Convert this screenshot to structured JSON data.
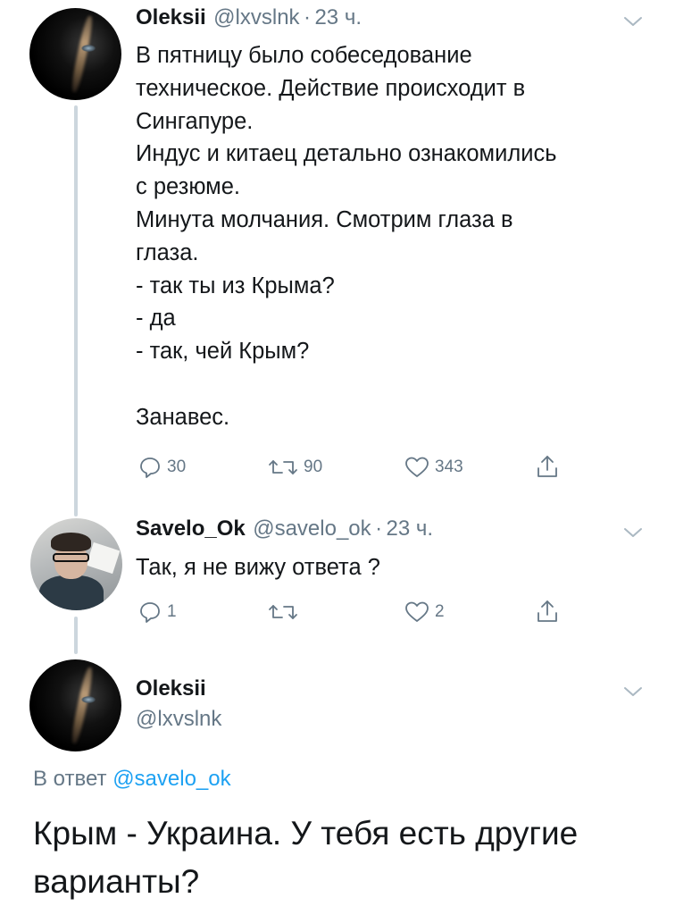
{
  "tweet1": {
    "display_name": "Oleksii",
    "handle": "@lxvslnk",
    "time": "23 ч.",
    "text": "В пятницу было собеседование\nтехническое. Действие происходит в\nСингапуре.\nИндус и китаец детально ознакомились\nс резюме.\nМинута молчания. Смотрим глаза в\nглаза.\n- так ты из Крыма?\n- да\n- так, чей Крым?\n\nЗанавес.",
    "reply_count": "30",
    "retweet_count": "90",
    "like_count": "343"
  },
  "tweet2": {
    "display_name": "Savelo_Ok",
    "handle": "@savelo_ok",
    "time": "23 ч.",
    "text": "Так, я не вижу ответа ?",
    "reply_count": "1",
    "retweet_count": "",
    "like_count": "2"
  },
  "tweet3": {
    "display_name": "Oleksii",
    "handle": "@lxvslnk",
    "reply_prefix": "В ответ",
    "reply_to": "@savelo_ok",
    "text": "Крым - Украина. У тебя есть другие варианты?"
  },
  "separator": "·",
  "icons": {
    "reply": "reply-icon",
    "retweet": "retweet-icon",
    "like": "heart-icon",
    "share": "share-icon",
    "more": "chevron-down-icon"
  },
  "colors": {
    "text": "#14171a",
    "secondary": "#657786",
    "link": "#1da1f2",
    "thread_line": "#ccd6dd"
  }
}
